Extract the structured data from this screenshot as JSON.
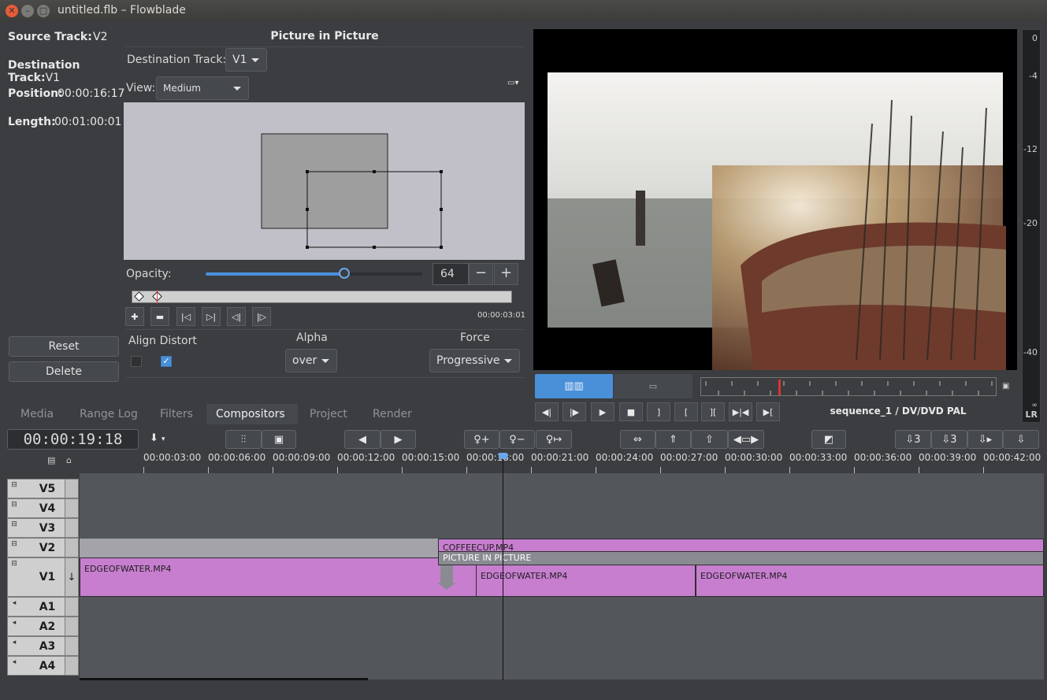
{
  "window": {
    "title": "untitled.flb – Flowblade"
  },
  "info": {
    "source_track_label": "Source Track:",
    "source_track_value": "V2",
    "destination_track_label": "Destination Track:",
    "destination_track_value": "V1",
    "position_label": "Position:",
    "position_value": "00:00:16:17",
    "length_label": "Length:",
    "length_value": "00:01:00:01",
    "reset_label": "Reset",
    "delete_label": "Delete"
  },
  "editor": {
    "title": "Picture in Picture",
    "dest_track_label": "Destination Track:",
    "dest_track_value": "V1",
    "view_label": "View:",
    "view_value": "Medium",
    "opacity_label": "Opacity:",
    "opacity_value": "64",
    "opacity_fraction": 0.64,
    "keyframe_time": "00:00:03:01",
    "align_distort_label": "Align Distort",
    "alpha_label": "Alpha",
    "alpha_value": "over",
    "force_label": "Force",
    "force_value": "Progressive",
    "align_checked": false,
    "distort_checked": true
  },
  "monitor": {
    "sequence_label": "sequence_1 / DV/DVD PAL",
    "vu_labels": [
      "0",
      "-4",
      "-12",
      "-20",
      "-40",
      "∞",
      "LR"
    ]
  },
  "tabs": [
    "Media",
    "Range Log",
    "Filters",
    "Compositors",
    "Project",
    "Render"
  ],
  "active_tab": "Compositors",
  "timeline": {
    "timecode": "00:00:19:18",
    "ruler": [
      "00:00:03:00",
      "00:00:06:00",
      "00:00:09:00",
      "00:00:12:00",
      "00:00:15:00",
      "00:00:18:00",
      "00:00:21:00",
      "00:00:24:00",
      "00:00:27:00",
      "00:00:30:00",
      "00:00:33:00",
      "00:00:36:00",
      "00:00:39:00",
      "00:00:42:00"
    ],
    "tracks": [
      "V5",
      "V4",
      "V3",
      "V2",
      "V1",
      "A1",
      "A2",
      "A3",
      "A4"
    ],
    "clips": {
      "v2_clip": "COFFEECUP.MP4",
      "compositor": "PICTURE IN PICTURE",
      "v1_clip_1": "EDGEOFWATER.MP4",
      "v1_clip_2": "EDGEOFWATER.MP4",
      "v1_clip_3": "EDGEOFWATER.MP4"
    }
  },
  "colors": {
    "accent": "#4a90d9",
    "clip": "#c77ecf",
    "panel": "#3b3d40"
  }
}
